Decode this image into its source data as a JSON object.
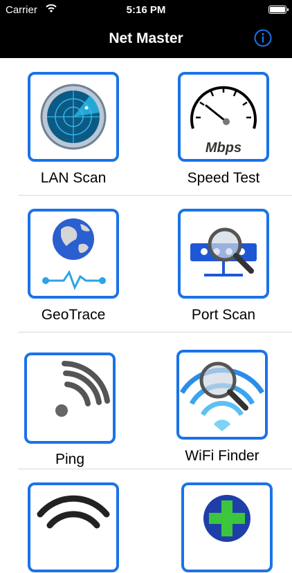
{
  "status_bar": {
    "carrier": "Carrier",
    "time": "5:16 PM"
  },
  "nav": {
    "title": "Net Master",
    "info_icon": "info-icon"
  },
  "tiles": [
    {
      "label": "LAN Scan",
      "icon": "radar-icon"
    },
    {
      "label": "Speed Test",
      "icon": "speedometer-icon",
      "icon_text": "Mbps"
    },
    {
      "label": "GeoTrace",
      "icon": "globe-trace-icon"
    },
    {
      "label": "Port Scan",
      "icon": "port-scan-icon"
    },
    {
      "label": "Ping",
      "icon": "ping-icon"
    },
    {
      "label": "WiFi Finder",
      "icon": "wifi-finder-icon"
    },
    {
      "label": "",
      "icon": "wifi-icon"
    },
    {
      "label": "",
      "icon": "plus-icon"
    }
  ],
  "colors": {
    "accent": "#1a73e8",
    "bar": "#000000"
  }
}
